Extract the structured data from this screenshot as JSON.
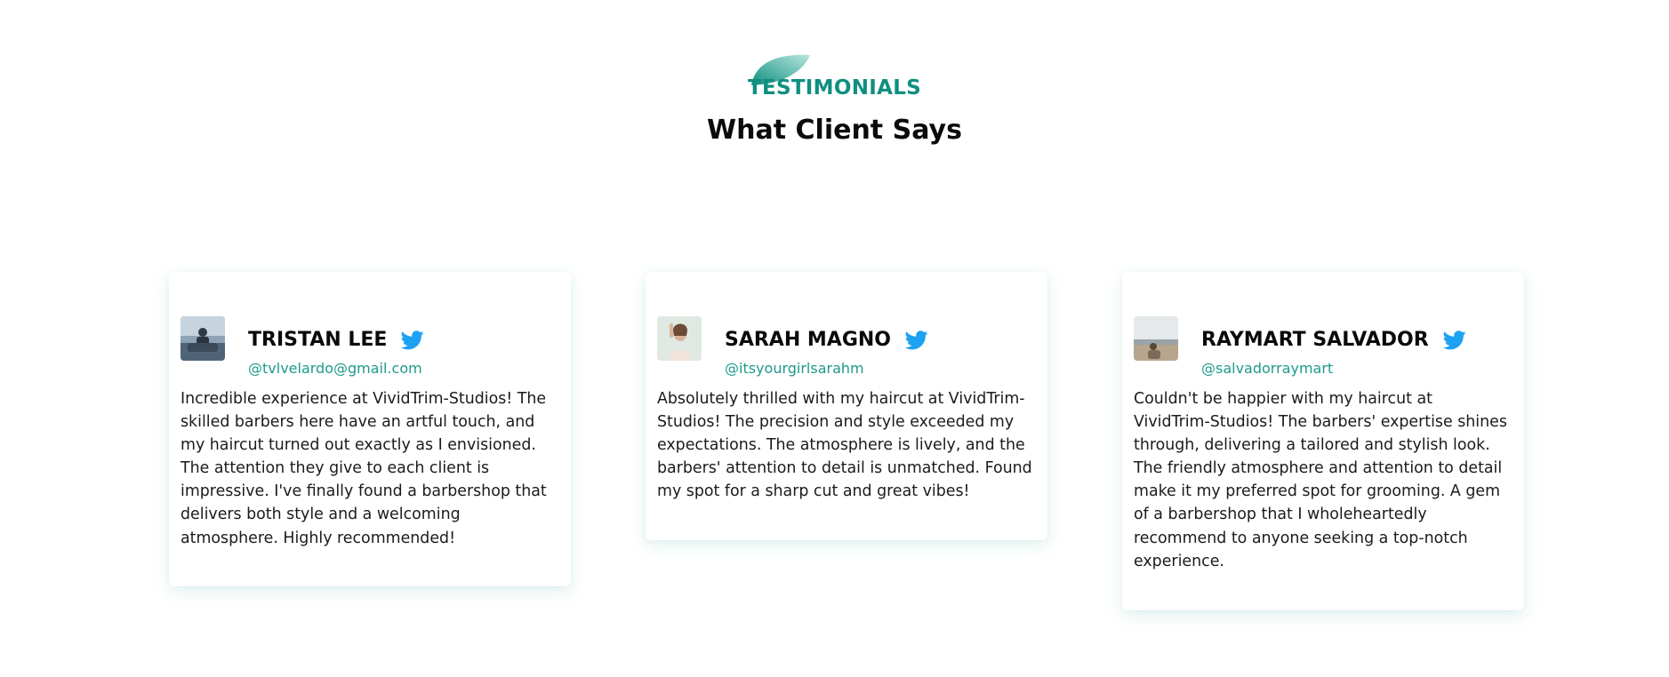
{
  "header": {
    "eyebrow": "TESTIMONIALS",
    "title": "What Client Says"
  },
  "colors": {
    "accent": "#0f8f80",
    "handle": "#1f9a8c",
    "twitter": "#1da1f2"
  },
  "testimonials": [
    {
      "name": "TRISTAN LEE",
      "handle": "@tvlvelardo@gmail.com",
      "icon": "twitter-icon",
      "text": "Incredible experience at VividTrim-Studios! The skilled barbers here have an artful touch, and my haircut turned out exactly as I envisioned. The attention they give to each client is impressive. I've finally found a barbershop that delivers both style and a welcoming atmosphere. Highly recommended!"
    },
    {
      "name": "SARAH MAGNO",
      "handle": "@itsyourgirlsarahm",
      "icon": "twitter-icon",
      "text": "Absolutely thrilled with my haircut at VividTrim-Studios! The precision and style exceeded my expectations. The atmosphere is lively, and the barbers' attention to detail is unmatched. Found my spot for a sharp cut and great vibes!"
    },
    {
      "name": "RAYMART SALVADOR",
      "handle": "@salvadorraymart",
      "icon": "twitter-icon",
      "text": "Couldn't be happier with my haircut at VividTrim-Studios! The barbers' expertise shines through, delivering a tailored and stylish look. The friendly atmosphere and attention to detail make it my preferred spot for grooming. A gem of a barbershop that I wholeheartedly recommend to anyone seeking a top-notch experience."
    }
  ]
}
